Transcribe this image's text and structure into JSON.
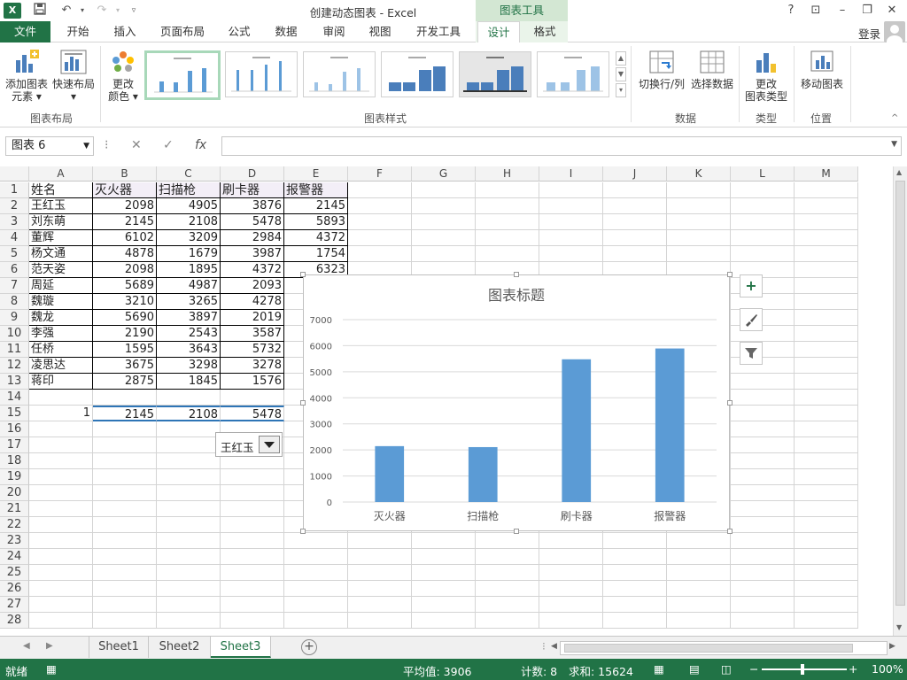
{
  "window": {
    "title": "创建动态图表 - Excel",
    "context_tab_group": "图表工具",
    "help": "?"
  },
  "tabs": {
    "file": "文件",
    "home": "开始",
    "insert": "插入",
    "layout": "页面布局",
    "formulas": "公式",
    "data": "数据",
    "review": "审阅",
    "view": "视图",
    "developer": "开发工具",
    "design": "设计",
    "format": "格式"
  },
  "account": {
    "login": "登录"
  },
  "ribbon": {
    "add_element_1": "添加图表",
    "add_element_2": "元素",
    "quick_layout": "快速布局",
    "change_color_1": "更改",
    "change_color_2": "颜色",
    "switch_row_col": "切换行/列",
    "select_data": "选择数据",
    "change_type_1": "更改",
    "change_type_2": "图表类型",
    "move_chart": "移动图表",
    "groups": {
      "layouts": "图表布局",
      "styles": "图表样式",
      "data": "数据",
      "type": "类型",
      "location": "位置"
    }
  },
  "formula_bar": {
    "name_box": "图表 6",
    "fx": "fx",
    "cancel": "✕",
    "enter": "✓"
  },
  "columns": [
    "A",
    "B",
    "C",
    "D",
    "E",
    "F",
    "G",
    "H",
    "I",
    "J",
    "K",
    "L",
    "M"
  ],
  "rows": [
    "1",
    "2",
    "3",
    "4",
    "5",
    "6",
    "7",
    "8",
    "9",
    "10",
    "11",
    "12",
    "13",
    "14",
    "15",
    "16",
    "17",
    "18",
    "19",
    "20",
    "21",
    "22",
    "23",
    "24",
    "25",
    "26",
    "27",
    "28"
  ],
  "table": {
    "header": [
      "姓名",
      "灭火器",
      "扫描枪",
      "刷卡器",
      "报警器"
    ],
    "rows": [
      [
        "王红玉",
        "2098",
        "4905",
        "3876",
        "2145"
      ],
      [
        "刘东萌",
        "2145",
        "2108",
        "5478",
        "5893"
      ],
      [
        "董辉",
        "6102",
        "3209",
        "2984",
        "4372"
      ],
      [
        "杨文通",
        "4878",
        "1679",
        "3987",
        "1754"
      ],
      [
        "范天姿",
        "2098",
        "1895",
        "4372",
        "6323"
      ],
      [
        "周延",
        "5689",
        "4987",
        "2093",
        ""
      ],
      [
        "魏璇",
        "3210",
        "3265",
        "4278",
        ""
      ],
      [
        "魏龙",
        "5690",
        "3897",
        "2019",
        ""
      ],
      [
        "李强",
        "2190",
        "2543",
        "3587",
        ""
      ],
      [
        "任桥",
        "1595",
        "3643",
        "5732",
        ""
      ],
      [
        "凌思达",
        "3675",
        "3298",
        "3278",
        ""
      ],
      [
        "蒋印",
        "2875",
        "1845",
        "1576",
        ""
      ]
    ],
    "row15": [
      "1",
      "2145",
      "2108",
      "5478"
    ]
  },
  "combo": {
    "value": "王红玉"
  },
  "sheets": [
    "Sheet1",
    "Sheet2",
    "Sheet3"
  ],
  "status": {
    "ready": "就绪",
    "average": "平均值: 3906",
    "count": "计数: 8",
    "sum": "求和: 15624",
    "zoom": "100%"
  },
  "chart_data": {
    "type": "bar",
    "title": "图表标题",
    "categories": [
      "灭火器",
      "扫描枪",
      "刷卡器",
      "报警器"
    ],
    "values": [
      2145,
      2108,
      5478,
      5893
    ],
    "ylim": [
      0,
      7000
    ],
    "yticks": [
      "0",
      "1000",
      "2000",
      "3000",
      "4000",
      "5000",
      "6000",
      "7000"
    ],
    "grid": true,
    "color": "#5b9bd5"
  },
  "colors": {
    "excel_green": "#217346",
    "bar": "#5b9bd5"
  }
}
